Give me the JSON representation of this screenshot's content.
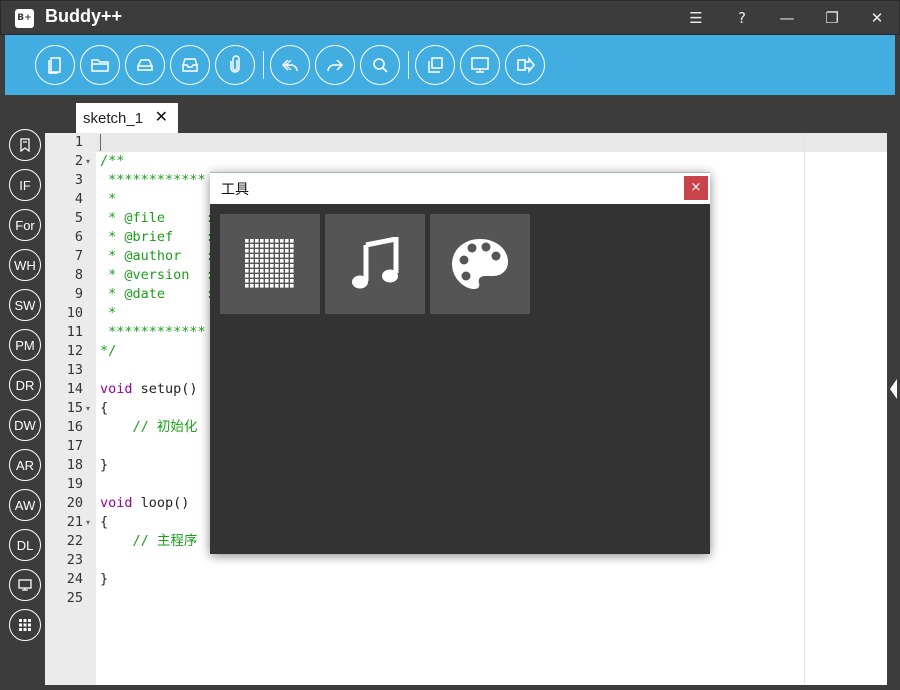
{
  "window": {
    "logo_text": "B+",
    "title": "Buddy++",
    "controls": [
      "☰",
      "?",
      "—",
      "❐",
      "✕"
    ]
  },
  "toolbar": {
    "buttons": [
      "new-file",
      "open-folder",
      "save",
      "save-as",
      "attach",
      "undo",
      "redo",
      "search",
      "copy",
      "monitor",
      "upload"
    ]
  },
  "sidebar": {
    "items": [
      {
        "name": "bookmark",
        "label": ""
      },
      {
        "name": "if",
        "label": "IF"
      },
      {
        "name": "for",
        "label": "For"
      },
      {
        "name": "while",
        "label": "WH"
      },
      {
        "name": "switch",
        "label": "SW"
      },
      {
        "name": "pinmode",
        "label": "PM"
      },
      {
        "name": "digitalread",
        "label": "DR"
      },
      {
        "name": "digitalwrite",
        "label": "DW"
      },
      {
        "name": "analogread",
        "label": "AR"
      },
      {
        "name": "analogwrite",
        "label": "AW"
      },
      {
        "name": "delay",
        "label": "DL"
      },
      {
        "name": "serial-monitor",
        "label": ""
      },
      {
        "name": "apps-grid",
        "label": ""
      }
    ]
  },
  "tab": {
    "label": "sketch_1",
    "close": "✕"
  },
  "editor": {
    "lines": [
      {
        "n": "1",
        "text": "",
        "cls": "c-plain",
        "fold": false
      },
      {
        "n": "2",
        "text": "/**",
        "cls": "c-comment",
        "fold": true
      },
      {
        "n": "3",
        "text": " ************",
        "cls": "c-comment",
        "fold": false
      },
      {
        "n": "4",
        "text": " *",
        "cls": "c-comment",
        "fold": false
      },
      {
        "n": "5",
        "text": " * @file     :",
        "cls": "c-comment",
        "fold": false
      },
      {
        "n": "6",
        "text": " * @brief    :",
        "cls": "c-comment",
        "fold": false
      },
      {
        "n": "7",
        "text": " * @author   :",
        "cls": "c-comment",
        "fold": false
      },
      {
        "n": "8",
        "text": " * @version  :",
        "cls": "c-comment",
        "fold": false
      },
      {
        "n": "9",
        "text": " * @date     :",
        "cls": "c-comment",
        "fold": false
      },
      {
        "n": "10",
        "text": " *",
        "cls": "c-comment",
        "fold": false
      },
      {
        "n": "11",
        "text": " ************",
        "cls": "c-comment",
        "fold": false
      },
      {
        "n": "12",
        "text": "*/",
        "cls": "c-comment",
        "fold": false
      },
      {
        "n": "13",
        "text": "",
        "cls": "c-plain",
        "fold": false
      },
      {
        "n": "14",
        "kw": "void",
        "fn": " setup()",
        "fold": false
      },
      {
        "n": "15",
        "text": "{",
        "cls": "c-plain",
        "fold": true
      },
      {
        "n": "16",
        "text": "    // 初始化",
        "cls": "c-zh-comment",
        "fold": false
      },
      {
        "n": "17",
        "text": "",
        "cls": "c-plain",
        "fold": false
      },
      {
        "n": "18",
        "text": "}",
        "cls": "c-plain",
        "fold": false
      },
      {
        "n": "19",
        "text": "",
        "cls": "c-plain",
        "fold": false
      },
      {
        "n": "20",
        "kw": "void",
        "fn": " loop()",
        "fold": false
      },
      {
        "n": "21",
        "text": "{",
        "cls": "c-plain",
        "fold": true
      },
      {
        "n": "22",
        "text": "    // 主程序",
        "cls": "c-zh-comment",
        "fold": false
      },
      {
        "n": "23",
        "text": "",
        "cls": "c-plain",
        "fold": false
      },
      {
        "n": "24",
        "text": "}",
        "cls": "c-plain",
        "fold": false
      },
      {
        "n": "25",
        "text": "",
        "cls": "c-plain",
        "fold": false
      }
    ]
  },
  "dialog": {
    "title": "工具",
    "close": "×",
    "tools": [
      "led-matrix",
      "music",
      "palette"
    ]
  }
}
